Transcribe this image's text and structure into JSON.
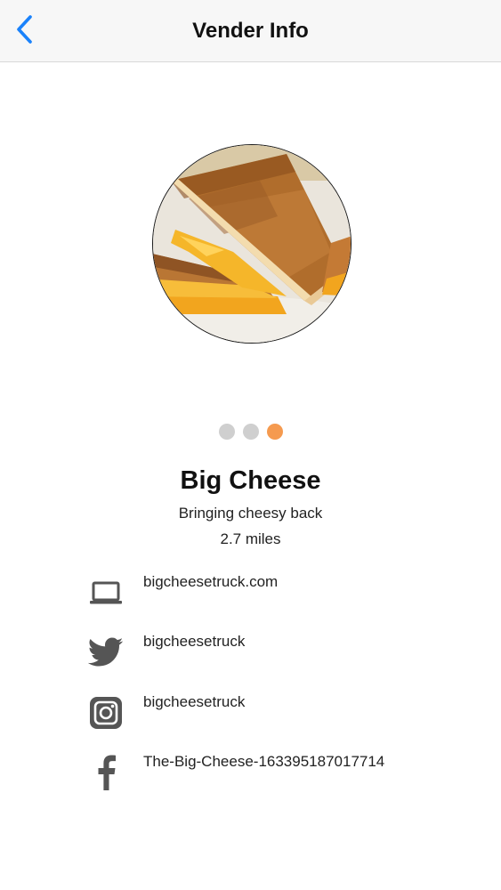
{
  "nav": {
    "title": "Vender Info",
    "back_icon": "chevron-left-icon",
    "accent_color": "#1a82fb"
  },
  "carousel": {
    "photo_description": "grilled cheese sandwich",
    "page_count": 3,
    "active_page": 3,
    "active_dot_color": "#f59a4f",
    "inactive_dot_color": "#cfcfcf"
  },
  "vendor": {
    "name": "Big Cheese",
    "tagline": "Bringing cheesy back",
    "distance": "2.7 miles"
  },
  "contacts": [
    {
      "type": "website",
      "icon": "laptop-icon",
      "value": "bigcheesetruck.com"
    },
    {
      "type": "twitter",
      "icon": "twitter-icon",
      "value": "bigcheesetruck"
    },
    {
      "type": "instagram",
      "icon": "instagram-icon",
      "value": "bigcheesetruck"
    },
    {
      "type": "facebook",
      "icon": "facebook-icon",
      "value": "The-Big-Cheese-163395187017714"
    }
  ]
}
